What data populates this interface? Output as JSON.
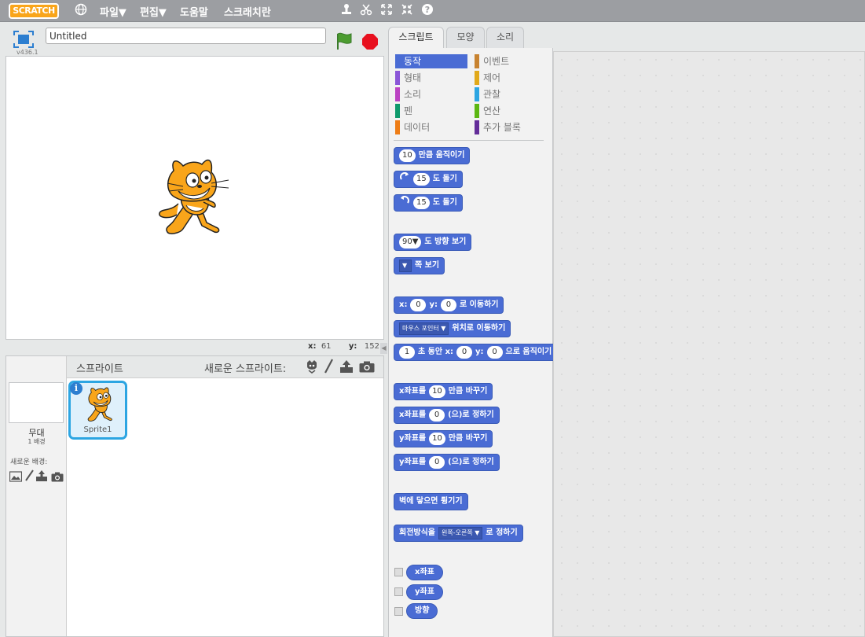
{
  "menubar": {
    "logo": "SCRATCH",
    "file": "파일▼",
    "edit": "편집▼",
    "help": "도움말",
    "tips": "스크래치란"
  },
  "stage": {
    "title_value": "Untitled",
    "version": "v436.1",
    "x_label": "x:",
    "x_value": "61",
    "y_label": "y:",
    "y_value": "152"
  },
  "sprites": {
    "header": "스프라이트",
    "new_sprite": "새로운 스프라이트:",
    "stage_label": "무대",
    "backdrop_count": "1 배경",
    "new_backdrop": "새로운 배경:",
    "sprite1": "Sprite1"
  },
  "tabs": [
    "스크립트",
    "모양",
    "소리"
  ],
  "categories": [
    {
      "label": "동작",
      "color": "#4a6cd4"
    },
    {
      "label": "이벤트",
      "color": "#c88330"
    },
    {
      "label": "형태",
      "color": "#8a55d7"
    },
    {
      "label": "제어",
      "color": "#e1a91a"
    },
    {
      "label": "소리",
      "color": "#bb42c3"
    },
    {
      "label": "관찰",
      "color": "#2ca5e2"
    },
    {
      "label": "펜",
      "color": "#0e9a6c"
    },
    {
      "label": "연산",
      "color": "#5cb712"
    },
    {
      "label": "데이터",
      "color": "#ee7d16"
    },
    {
      "label": "추가 블록",
      "color": "#632d99"
    }
  ],
  "blocks": {
    "move_num": "10",
    "move": "만큼 움직이기",
    "turn_r_num": "15",
    "turn_r": "도 돌기",
    "turn_l_num": "15",
    "turn_l": "도 돌기",
    "point_dir_num": "90▼",
    "point_dir": "도 방향 보기",
    "point_towards_dd": "▼",
    "point_towards": "쪽 보기",
    "goto_x": "x:",
    "goto_x_num": "0",
    "goto_y": "y:",
    "goto_y_num": "0",
    "goto_xy": "로 이동하기",
    "goto_dd": "마우스 포인터 ▼",
    "goto": "위치로 이동하기",
    "glide_num": "1",
    "glide_a": "초 동안 x:",
    "glide_x": "0",
    "glide_b": "y:",
    "glide_y": "0",
    "glide_c": "으로 움직이기",
    "change_x": "x좌표를",
    "change_x_num": "10",
    "change_x_b": "만큼 바꾸기",
    "set_x": "x좌표를",
    "set_x_num": "0",
    "set_x_b": "(으)로 정하기",
    "change_y": "y좌표를",
    "change_y_num": "10",
    "change_y_b": "만큼 바꾸기",
    "set_y": "y좌표를",
    "set_y_num": "0",
    "set_y_b": "(으)로 정하기",
    "bounce": "벽에 닿으면 튕기기",
    "rot_style": "회전방식을",
    "rot_style_dd": "왼쪽-오른쪽 ▼",
    "rot_style_b": "로 정하기",
    "rep_x": "x좌표",
    "rep_y": "y좌표",
    "rep_dir": "방향"
  }
}
